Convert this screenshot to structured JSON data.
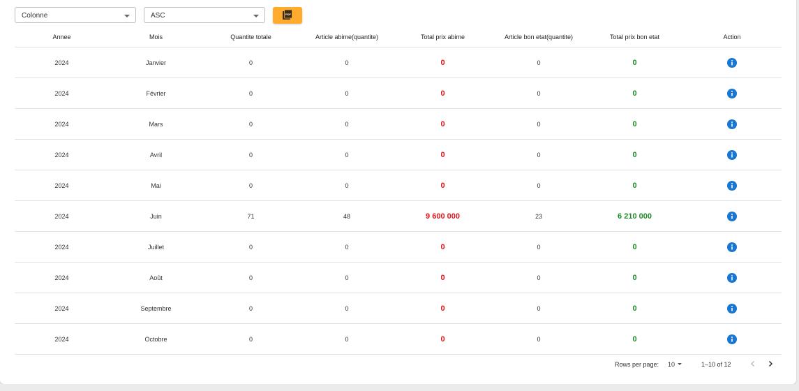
{
  "toolbar": {
    "column_select": "Colonne",
    "order_select": "ASC",
    "pdf_label": "PDF"
  },
  "table": {
    "headers": [
      "Annee",
      "Mois",
      "Quantite totale",
      "Article abime(quantite)",
      "Total prix abime",
      "Article bon etat(quantite)",
      "Total prix bon etat",
      "Action"
    ],
    "rows": [
      [
        "2024",
        "Janvier",
        "0",
        "0",
        "0",
        "0",
        "0"
      ],
      [
        "2024",
        "Février",
        "0",
        "0",
        "0",
        "0",
        "0"
      ],
      [
        "2024",
        "Mars",
        "0",
        "0",
        "0",
        "0",
        "0"
      ],
      [
        "2024",
        "Avril",
        "0",
        "0",
        "0",
        "0",
        "0"
      ],
      [
        "2024",
        "Mai",
        "0",
        "0",
        "0",
        "0",
        "0"
      ],
      [
        "2024",
        "Juin",
        "71",
        "48",
        "9 600 000",
        "23",
        "6 210 000"
      ],
      [
        "2024",
        "Juillet",
        "0",
        "0",
        "0",
        "0",
        "0"
      ],
      [
        "2024",
        "Août",
        "0",
        "0",
        "0",
        "0",
        "0"
      ],
      [
        "2024",
        "Septembre",
        "0",
        "0",
        "0",
        "0",
        "0"
      ],
      [
        "2024",
        "Octobre",
        "0",
        "0",
        "0",
        "0",
        "0"
      ]
    ]
  },
  "pagination": {
    "rows_per_page_label": "Rows per page:",
    "rows_per_page_value": "10",
    "range": "1–10 of 12"
  },
  "colors": {
    "damaged_total": "#e3151a",
    "good_total": "#1f8a2a",
    "info_icon": "#1976d2",
    "pdf_button": "#ffab2e"
  }
}
